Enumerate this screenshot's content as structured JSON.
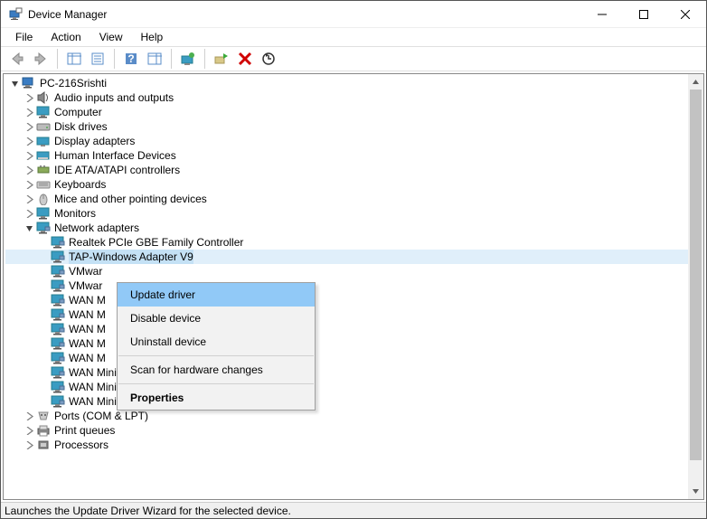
{
  "window": {
    "title": "Device Manager"
  },
  "menu": {
    "file": "File",
    "action": "Action",
    "view": "View",
    "help": "Help"
  },
  "tree": {
    "root": "PC-216Srishti",
    "audio": "Audio inputs and outputs",
    "computer": "Computer",
    "disk": "Disk drives",
    "display": "Display adapters",
    "hid": "Human Interface Devices",
    "ide": "IDE ATA/ATAPI controllers",
    "keyboards": "Keyboards",
    "mice": "Mice and other pointing devices",
    "monitors": "Monitors",
    "network": "Network adapters",
    "net_realtek": "Realtek PCIe GBE Family Controller",
    "net_tap": "TAP-Windows Adapter V9",
    "net_vmware1": "VMwar",
    "net_vmware2": "VMwar",
    "net_wan1": "WAN M",
    "net_wan2": "WAN M",
    "net_wan3": "WAN M",
    "net_wan4": "WAN M",
    "net_wan5": "WAN M",
    "net_wan_pppoe": "WAN Miniport (PPPOE)",
    "net_wan_pptp": "WAN Miniport (PPTP)",
    "net_wan_sstp": "WAN Miniport (SSTP)",
    "ports": "Ports (COM & LPT)",
    "printq": "Print queues",
    "processors": "Processors"
  },
  "context": {
    "update": "Update driver",
    "disable": "Disable device",
    "uninstall": "Uninstall device",
    "scan": "Scan for hardware changes",
    "properties": "Properties"
  },
  "status": "Launches the Update Driver Wizard for the selected device."
}
